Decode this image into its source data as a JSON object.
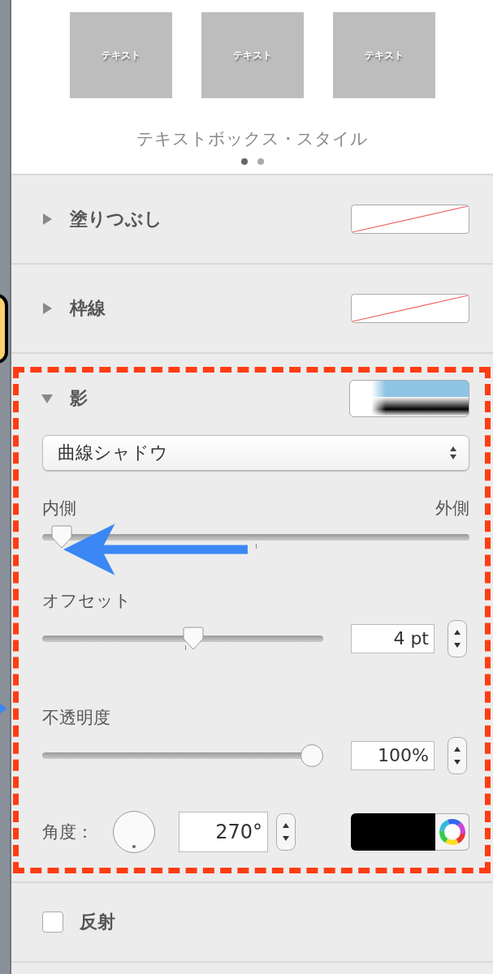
{
  "style_presets": {
    "thumbnails": [
      {
        "label": "テキスト"
      },
      {
        "label": "テキスト"
      },
      {
        "label": "テキスト"
      }
    ],
    "title": "テキストボックス・スタイル",
    "pages": [
      {
        "selected": true
      },
      {
        "selected": false
      }
    ]
  },
  "sections": [
    {
      "label": "塗りつぶし",
      "expanded": false
    },
    {
      "label": "枠線",
      "expanded": false
    }
  ],
  "shadow": {
    "label": "影",
    "expanded": true,
    "type": "曲線シャドウ",
    "spread": {
      "min_label": "内側",
      "max_label": "外側",
      "level": 0.02
    },
    "offset": {
      "label": "オフセット",
      "level": 0.54,
      "value": "4 pt"
    },
    "opacity": {
      "label": "不透明度",
      "level": 1,
      "value": "100%"
    },
    "angle": {
      "label": "角度：",
      "value": "270°"
    }
  },
  "reflection": {
    "label": "反射",
    "checked": false
  }
}
